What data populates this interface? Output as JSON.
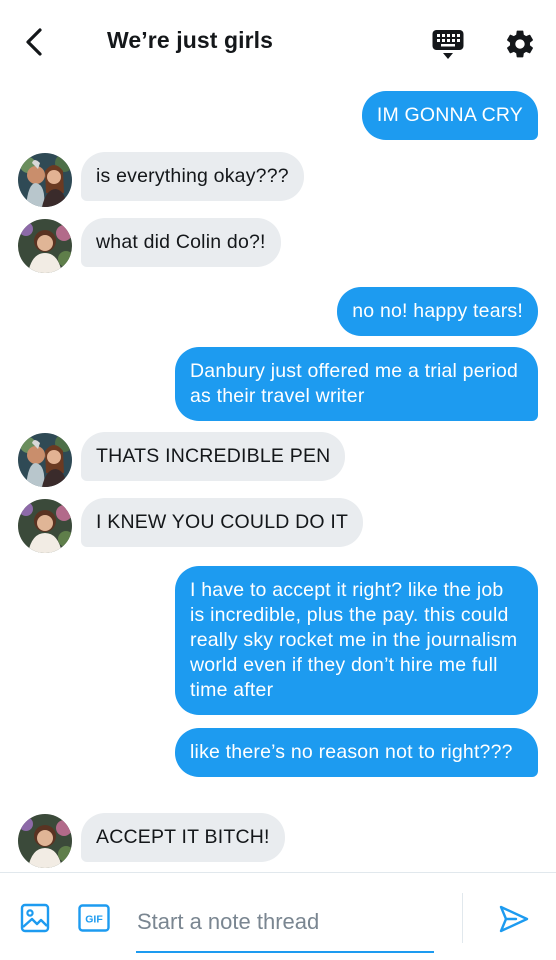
{
  "header": {
    "title": "We’re just girls",
    "back_icon": "chevron-left-icon",
    "keyboard_icon": "keyboard-icon",
    "settings_icon": "gear-icon"
  },
  "messages": [
    {
      "side": "out",
      "text": "IM GONNA CRY"
    },
    {
      "side": "in",
      "avatar": "avatar-friend-1",
      "text": "is everything okay???"
    },
    {
      "side": "in",
      "avatar": "avatar-friend-2",
      "text": "what did Colin do?!"
    },
    {
      "side": "out",
      "text": "no no! happy tears!"
    },
    {
      "side": "out",
      "text": "Danbury just offered me a trial period as their travel writer"
    },
    {
      "side": "in",
      "avatar": "avatar-friend-1",
      "text": "THATS INCREDIBLE PEN"
    },
    {
      "side": "in",
      "avatar": "avatar-friend-2",
      "text": "I KNEW YOU COULD DO IT"
    },
    {
      "side": "out",
      "text": "I have to accept it right? like the job is incredible, plus the pay. this could really sky rocket me in the journalism world even if they don’t hire me full time after"
    },
    {
      "side": "out",
      "text": "like there’s no reason not to right???"
    },
    {
      "side": "in",
      "avatar": "avatar-friend-2",
      "text": "ACCEPT IT BITCH!"
    }
  ],
  "composer": {
    "placeholder": "Start a note thread",
    "gif_label": "GIF",
    "image_icon": "image-icon",
    "send_icon": "send-icon"
  },
  "colors": {
    "accent": "#1d9bf0",
    "incoming_bubble": "#e9ecef",
    "text": "#14171a"
  }
}
